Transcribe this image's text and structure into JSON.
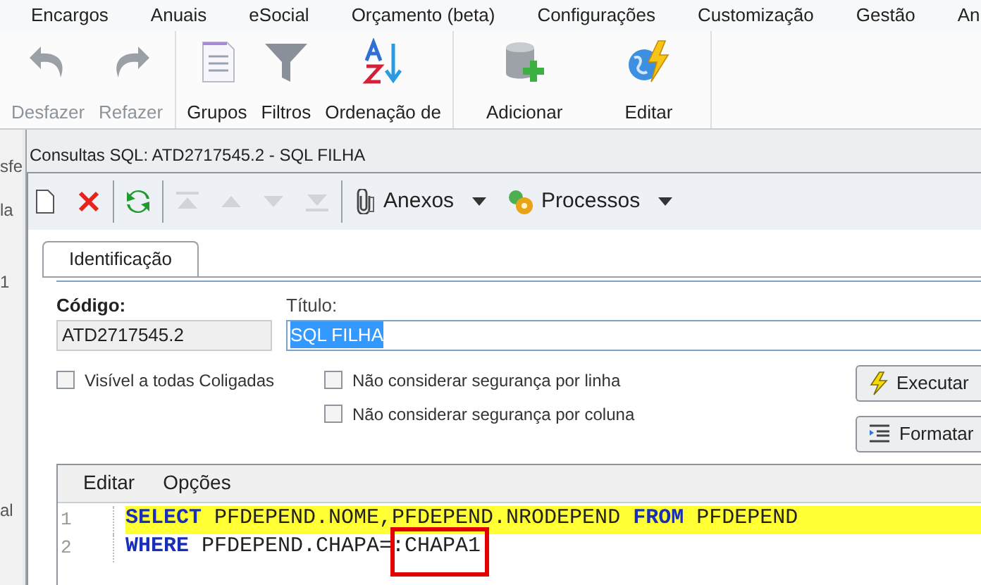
{
  "menu": [
    {
      "label": "Encargos"
    },
    {
      "label": "Anuais"
    },
    {
      "label": "eSocial"
    },
    {
      "label": "Orçamento (beta)"
    },
    {
      "label": "Configurações"
    },
    {
      "label": "Customização"
    },
    {
      "label": "Gestão"
    },
    {
      "label": "An"
    }
  ],
  "ribbon": [
    [
      {
        "kind": "undo",
        "label": "Desfazer",
        "disabled": true
      },
      {
        "kind": "redo",
        "label": "Refazer",
        "disabled": true
      }
    ],
    [
      {
        "kind": "groups",
        "label": "Grupos",
        "disabled": false
      },
      {
        "kind": "filter",
        "label": "Filtros",
        "disabled": false
      },
      {
        "kind": "sort",
        "label": "Ordenação de",
        "disabled": false
      }
    ],
    [
      {
        "kind": "add",
        "label": "Adicionar",
        "disabled": false
      },
      {
        "kind": "edit",
        "label": "Editar",
        "disabled": false
      }
    ]
  ],
  "background_window": {
    "fragments": [
      "sfe",
      "la",
      "1",
      "al"
    ]
  },
  "dialog": {
    "title": "Consultas SQL: ATD2717545.2 - SQL FILHA",
    "toolbar": [
      [
        {
          "kind": "new",
          "disabled": false
        },
        {
          "kind": "delete",
          "disabled": false
        }
      ],
      [
        {
          "kind": "refresh",
          "disabled": false
        }
      ],
      [
        {
          "kind": "first",
          "disabled": true
        },
        {
          "kind": "up",
          "disabled": true
        },
        {
          "kind": "down",
          "disabled": true
        },
        {
          "kind": "last",
          "disabled": true
        }
      ],
      [
        {
          "kind": "attach",
          "label": "Anexos",
          "disabled": false
        },
        {
          "kind": "process",
          "label": "Processos",
          "disabled": false
        }
      ]
    ],
    "tabs": [
      {
        "label": "Identificação",
        "selected": true
      }
    ],
    "code_field": {
      "label": "Código:",
      "value": "ATD2717545.2"
    },
    "title_field": {
      "label": "Título:",
      "value": "SQL FILHA",
      "selected": true
    },
    "checkboxes": [
      {
        "label": "Visível a todas Coligadas",
        "checked": false
      },
      {
        "label": "Não considerar segurança por linha",
        "checked": false
      },
      {
        "label": "Não considerar segurança por coluna",
        "checked": false
      }
    ],
    "buttons": [
      {
        "kind": "run",
        "label": "Executar"
      },
      {
        "kind": "format",
        "label": "Formatar"
      }
    ],
    "editor": {
      "menu": [
        "Editar",
        "Opções"
      ],
      "lines": [
        {
          "number": "1",
          "highlighted": true,
          "tokens": [
            {
              "kind": "keyword",
              "text": "SELECT"
            },
            {
              "kind": "text",
              "text": " PFDEPEND.NOME,PFDEPEND.NRODEPEND "
            },
            {
              "kind": "keyword",
              "text": "FROM"
            },
            {
              "kind": "text",
              "text": " PFDEPEND"
            }
          ]
        },
        {
          "number": "2",
          "highlighted": false,
          "tokens": [
            {
              "kind": "keyword",
              "text": "WHERE"
            },
            {
              "kind": "text",
              "text": " PFDEPEND.CHAPA="
            },
            {
              "kind": "text",
              "text": ":CHAPA1",
              "marked": true
            }
          ]
        }
      ]
    }
  }
}
